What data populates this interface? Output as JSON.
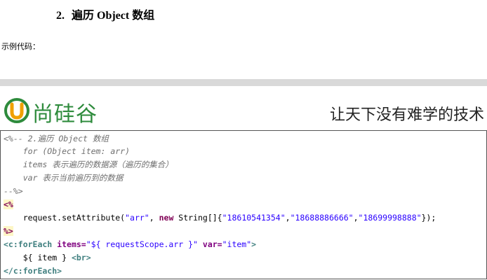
{
  "heading": {
    "number": "2.",
    "title": "遍历 Object 数组"
  },
  "caption": "示例代码：",
  "banner": {
    "brand": "尚硅谷",
    "slogan": "让天下没有难学的技术"
  },
  "code": {
    "c1": "<%-- 2.遍历 Object 数组",
    "c2": "    for (Object item: arr)",
    "c3": "    items 表示遍历的数据源（遍历的集合）",
    "c4": "    var 表示当前遍历到的数据",
    "c5": "--%>",
    "open": "<%",
    "indent": "    ",
    "req": "request.setAttribute(",
    "arg1": "\"arr\"",
    "comma": ", ",
    "newkw": "new",
    "typ": " String[]{",
    "v1": "\"18610541354\"",
    "v2": "\"18688886666\"",
    "v3": "\"18699998888\"",
    "sep": ",",
    "close_stmt": "});",
    "close": "%>",
    "fe_open": "<c:forEach",
    "items_attr": " items=",
    "items_val": "\"${ requestScope.arr }\"",
    "var_attr": " var=",
    "var_val": "\"item\"",
    "gt": ">",
    "expr": "${ item } ",
    "br": "<br>",
    "fe_close": "</c:forEach>"
  }
}
